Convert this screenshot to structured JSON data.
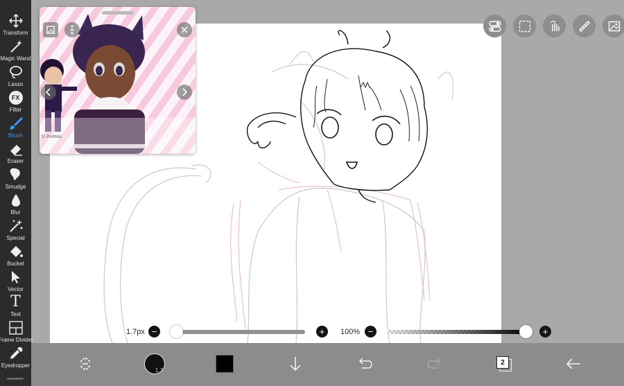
{
  "toolbar": {
    "tools": [
      {
        "label": "Transform",
        "icon": "transform-icon"
      },
      {
        "label": "Magic Wand",
        "icon": "magic-wand-icon"
      },
      {
        "label": "Lasso",
        "icon": "lasso-icon"
      },
      {
        "label": "Filter",
        "icon": "filter-icon"
      },
      {
        "label": "Brush",
        "icon": "brush-icon"
      },
      {
        "label": "Eraser",
        "icon": "eraser-icon"
      },
      {
        "label": "Smudge",
        "icon": "smudge-icon"
      },
      {
        "label": "Blur",
        "icon": "blur-icon"
      },
      {
        "label": "Special",
        "icon": "special-icon"
      },
      {
        "label": "Bucket",
        "icon": "bucket-icon"
      },
      {
        "label": "Vector",
        "icon": "vector-icon"
      },
      {
        "label": "Text",
        "icon": "text-icon"
      },
      {
        "label": "Frame Divider",
        "icon": "frame-divider-icon"
      },
      {
        "label": "Eyedropper",
        "icon": "eyedropper-icon"
      }
    ],
    "active_tool": "Brush",
    "active_color": "#3d9bff",
    "filter_glyph": "FX",
    "text_glyph": "T"
  },
  "reference": {
    "watermark": "ℳ Portfolio"
  },
  "brush_size": {
    "label": "1.7px",
    "value": 1.7,
    "minus": "−",
    "plus": "+",
    "level": 0.0
  },
  "opacity": {
    "label": "100%",
    "value": 100,
    "minus": "−",
    "plus": "+",
    "level": 1.0
  },
  "bottom_bar": {
    "brush_indicator": "1.7",
    "color": "#000000",
    "layer_count": "2"
  }
}
